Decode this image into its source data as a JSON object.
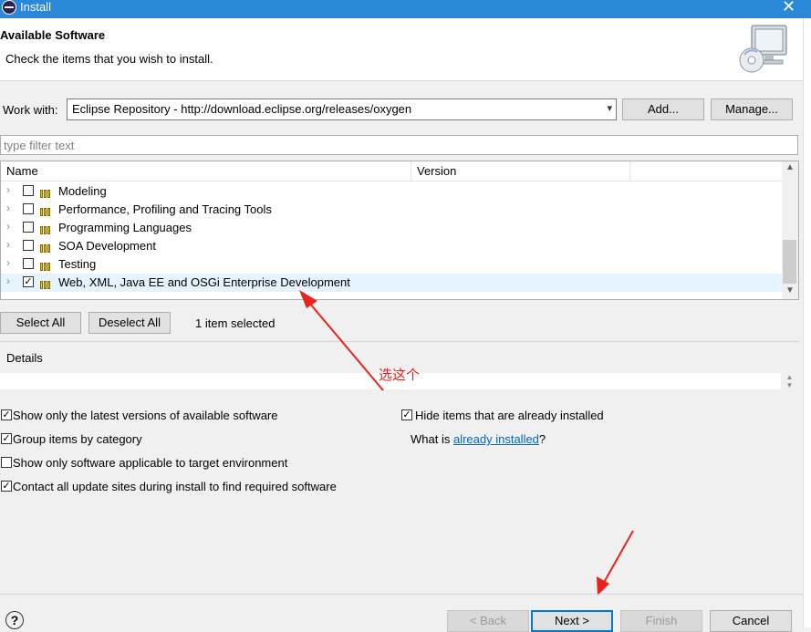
{
  "window": {
    "title": "Install"
  },
  "header": {
    "title": "Available Software",
    "subtitle": "Check the items that you wish to install."
  },
  "work_with": {
    "label": "Work with:",
    "value": "Eclipse Repository - http://download.eclipse.org/releases/oxygen",
    "add_label": "Add...",
    "manage_label": "Manage..."
  },
  "filter": {
    "placeholder": "type filter text"
  },
  "tree": {
    "columns": [
      "Name",
      "Version"
    ],
    "rows": [
      {
        "label": "Modeling",
        "checked": false
      },
      {
        "label": "Performance, Profiling and Tracing Tools",
        "checked": false
      },
      {
        "label": "Programming Languages",
        "checked": false
      },
      {
        "label": "SOA Development",
        "checked": false
      },
      {
        "label": "Testing",
        "checked": false
      },
      {
        "label": "Web, XML, Java EE and OSGi Enterprise Development",
        "checked": true
      }
    ]
  },
  "selection": {
    "select_all_label": "Select All",
    "deselect_all_label": "Deselect All",
    "status": "1 item selected"
  },
  "details": {
    "label": "Details"
  },
  "options": {
    "show_latest": {
      "label": "Show only the latest versions of available software",
      "checked": true
    },
    "group_by_category": {
      "label": "Group items by category",
      "checked": true
    },
    "target_env": {
      "label": "Show only software applicable to target environment",
      "checked": false
    },
    "contact_sites": {
      "label": "Contact all update sites during install to find required software",
      "checked": true
    },
    "hide_installed": {
      "label": "Hide items that are already installed",
      "checked": true
    },
    "what_is_prefix": "What is ",
    "what_is_link": "already installed",
    "what_is_suffix": "?"
  },
  "annotation": {
    "text": "选这个"
  },
  "footer": {
    "back_label": "< Back",
    "next_label": "Next >",
    "finish_label": "Finish",
    "cancel_label": "Cancel"
  }
}
